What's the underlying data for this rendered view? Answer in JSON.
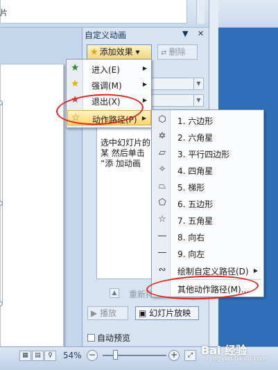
{
  "top": {
    "partial_label": "片"
  },
  "pane": {
    "title": "自定义动画",
    "dropdown_ctrl": "▼",
    "close_ctrl": "✕",
    "add_effect_label": "添加效果 ▾",
    "remove_label": "删除",
    "hint_text": "选中幻灯片的某 然后单击 “添 加动画",
    "reorder_label": "重新排",
    "play_label": "播放",
    "slideshow_label": "幻灯片放映",
    "autopreview_label": "自动预览"
  },
  "menu1": {
    "items": [
      {
        "label": "进入(E)",
        "icon": "entrance-star-icon"
      },
      {
        "label": "强调(M)",
        "icon": "emphasis-star-icon"
      },
      {
        "label": "退出(X)",
        "icon": "exit-star-icon"
      },
      {
        "label": "动作路径(P)",
        "icon": "motion-path-star-icon"
      }
    ]
  },
  "menu2": {
    "items": [
      {
        "label": "1. 六边形",
        "glyph": "⬡"
      },
      {
        "label": "2. 六角星",
        "glyph": "✡"
      },
      {
        "label": "3. 平行四边形",
        "glyph": "▱"
      },
      {
        "label": "4. 四角星",
        "glyph": "✧"
      },
      {
        "label": "5. 梯形",
        "glyph": "⏢"
      },
      {
        "label": "6. 五边形",
        "glyph": "⬠"
      },
      {
        "label": "7. 五角星",
        "glyph": "☆"
      },
      {
        "label": "8. 向右",
        "glyph": "—"
      },
      {
        "label": "9. 向左",
        "glyph": "—"
      },
      {
        "label": "绘制自定义路径(D)",
        "glyph": "∾"
      },
      {
        "label": "其他动作路径(M)...",
        "glyph": ""
      }
    ]
  },
  "status": {
    "zoom": "54%"
  },
  "watermark": {
    "brand": "Bai 经验",
    "url": "jingyan.baidu.com"
  }
}
